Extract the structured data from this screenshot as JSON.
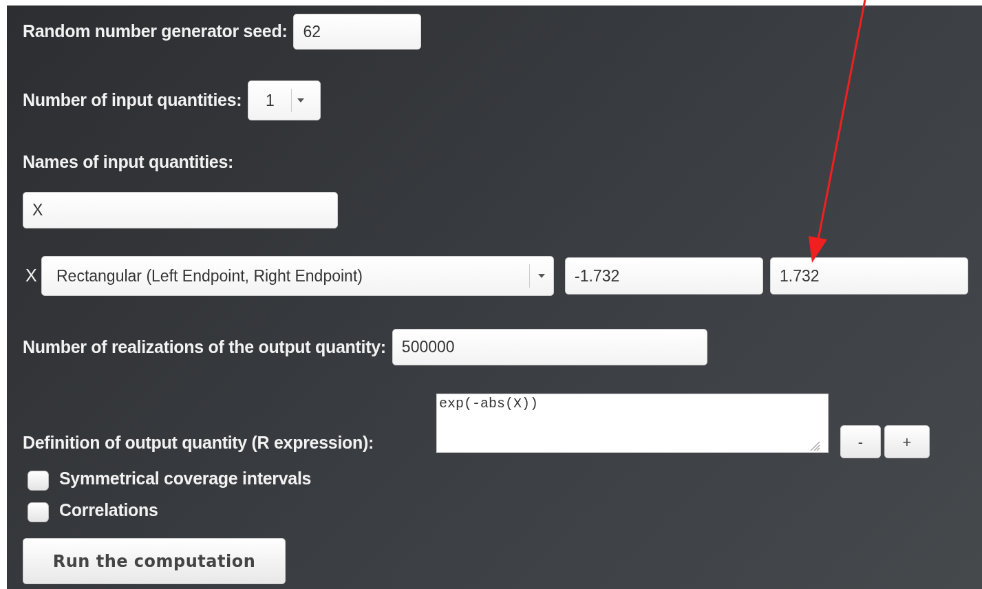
{
  "seed": {
    "label": "Random number generator seed:",
    "value": "62"
  },
  "input_count": {
    "label": "Number of input quantities:",
    "value": "1"
  },
  "input_names": {
    "label": "Names of input quantities:",
    "value": "X"
  },
  "inputs": [
    {
      "name": "X",
      "distribution": "Rectangular (Left Endpoint, Right Endpoint)",
      "parameters": [
        "-1.732",
        "1.732"
      ]
    }
  ],
  "realizations": {
    "label": "Number of realizations of the output quantity:",
    "value": "500000"
  },
  "output_definition": {
    "label": "Definition of output quantity (R expression):",
    "value": "exp(-abs(X))",
    "buttons": [
      "-",
      "+"
    ]
  },
  "options": [
    {
      "label": "Symmetrical coverage intervals",
      "checked": false
    },
    {
      "label": "Correlations",
      "checked": false
    }
  ],
  "run_button": "Run the computation"
}
